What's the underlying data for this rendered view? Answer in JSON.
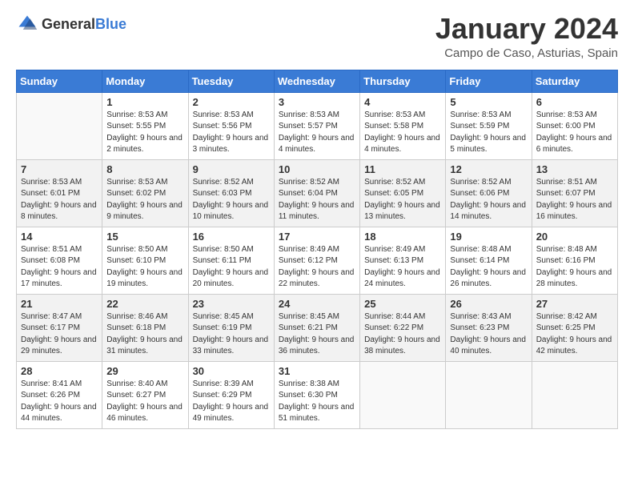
{
  "header": {
    "logo_general": "General",
    "logo_blue": "Blue",
    "month_title": "January 2024",
    "location": "Campo de Caso, Asturias, Spain"
  },
  "days_of_week": [
    "Sunday",
    "Monday",
    "Tuesday",
    "Wednesday",
    "Thursday",
    "Friday",
    "Saturday"
  ],
  "weeks": [
    [
      {
        "day": null
      },
      {
        "day": "1",
        "sunrise": "8:53 AM",
        "sunset": "5:55 PM",
        "daylight": "9 hours and 2 minutes."
      },
      {
        "day": "2",
        "sunrise": "8:53 AM",
        "sunset": "5:56 PM",
        "daylight": "9 hours and 3 minutes."
      },
      {
        "day": "3",
        "sunrise": "8:53 AM",
        "sunset": "5:57 PM",
        "daylight": "9 hours and 4 minutes."
      },
      {
        "day": "4",
        "sunrise": "8:53 AM",
        "sunset": "5:58 PM",
        "daylight": "9 hours and 4 minutes."
      },
      {
        "day": "5",
        "sunrise": "8:53 AM",
        "sunset": "5:59 PM",
        "daylight": "9 hours and 5 minutes."
      },
      {
        "day": "6",
        "sunrise": "8:53 AM",
        "sunset": "6:00 PM",
        "daylight": "9 hours and 6 minutes."
      }
    ],
    [
      {
        "day": "7",
        "sunrise": "8:53 AM",
        "sunset": "6:01 PM",
        "daylight": "9 hours and 8 minutes."
      },
      {
        "day": "8",
        "sunrise": "8:53 AM",
        "sunset": "6:02 PM",
        "daylight": "9 hours and 9 minutes."
      },
      {
        "day": "9",
        "sunrise": "8:52 AM",
        "sunset": "6:03 PM",
        "daylight": "9 hours and 10 minutes."
      },
      {
        "day": "10",
        "sunrise": "8:52 AM",
        "sunset": "6:04 PM",
        "daylight": "9 hours and 11 minutes."
      },
      {
        "day": "11",
        "sunrise": "8:52 AM",
        "sunset": "6:05 PM",
        "daylight": "9 hours and 13 minutes."
      },
      {
        "day": "12",
        "sunrise": "8:52 AM",
        "sunset": "6:06 PM",
        "daylight": "9 hours and 14 minutes."
      },
      {
        "day": "13",
        "sunrise": "8:51 AM",
        "sunset": "6:07 PM",
        "daylight": "9 hours and 16 minutes."
      }
    ],
    [
      {
        "day": "14",
        "sunrise": "8:51 AM",
        "sunset": "6:08 PM",
        "daylight": "9 hours and 17 minutes."
      },
      {
        "day": "15",
        "sunrise": "8:50 AM",
        "sunset": "6:10 PM",
        "daylight": "9 hours and 19 minutes."
      },
      {
        "day": "16",
        "sunrise": "8:50 AM",
        "sunset": "6:11 PM",
        "daylight": "9 hours and 20 minutes."
      },
      {
        "day": "17",
        "sunrise": "8:49 AM",
        "sunset": "6:12 PM",
        "daylight": "9 hours and 22 minutes."
      },
      {
        "day": "18",
        "sunrise": "8:49 AM",
        "sunset": "6:13 PM",
        "daylight": "9 hours and 24 minutes."
      },
      {
        "day": "19",
        "sunrise": "8:48 AM",
        "sunset": "6:14 PM",
        "daylight": "9 hours and 26 minutes."
      },
      {
        "day": "20",
        "sunrise": "8:48 AM",
        "sunset": "6:16 PM",
        "daylight": "9 hours and 28 minutes."
      }
    ],
    [
      {
        "day": "21",
        "sunrise": "8:47 AM",
        "sunset": "6:17 PM",
        "daylight": "9 hours and 29 minutes."
      },
      {
        "day": "22",
        "sunrise": "8:46 AM",
        "sunset": "6:18 PM",
        "daylight": "9 hours and 31 minutes."
      },
      {
        "day": "23",
        "sunrise": "8:45 AM",
        "sunset": "6:19 PM",
        "daylight": "9 hours and 33 minutes."
      },
      {
        "day": "24",
        "sunrise": "8:45 AM",
        "sunset": "6:21 PM",
        "daylight": "9 hours and 36 minutes."
      },
      {
        "day": "25",
        "sunrise": "8:44 AM",
        "sunset": "6:22 PM",
        "daylight": "9 hours and 38 minutes."
      },
      {
        "day": "26",
        "sunrise": "8:43 AM",
        "sunset": "6:23 PM",
        "daylight": "9 hours and 40 minutes."
      },
      {
        "day": "27",
        "sunrise": "8:42 AM",
        "sunset": "6:25 PM",
        "daylight": "9 hours and 42 minutes."
      }
    ],
    [
      {
        "day": "28",
        "sunrise": "8:41 AM",
        "sunset": "6:26 PM",
        "daylight": "9 hours and 44 minutes."
      },
      {
        "day": "29",
        "sunrise": "8:40 AM",
        "sunset": "6:27 PM",
        "daylight": "9 hours and 46 minutes."
      },
      {
        "day": "30",
        "sunrise": "8:39 AM",
        "sunset": "6:29 PM",
        "daylight": "9 hours and 49 minutes."
      },
      {
        "day": "31",
        "sunrise": "8:38 AM",
        "sunset": "6:30 PM",
        "daylight": "9 hours and 51 minutes."
      },
      {
        "day": null
      },
      {
        "day": null
      },
      {
        "day": null
      }
    ]
  ],
  "labels": {
    "sunrise_prefix": "Sunrise: ",
    "sunset_prefix": "Sunset: ",
    "daylight_prefix": "Daylight: "
  }
}
